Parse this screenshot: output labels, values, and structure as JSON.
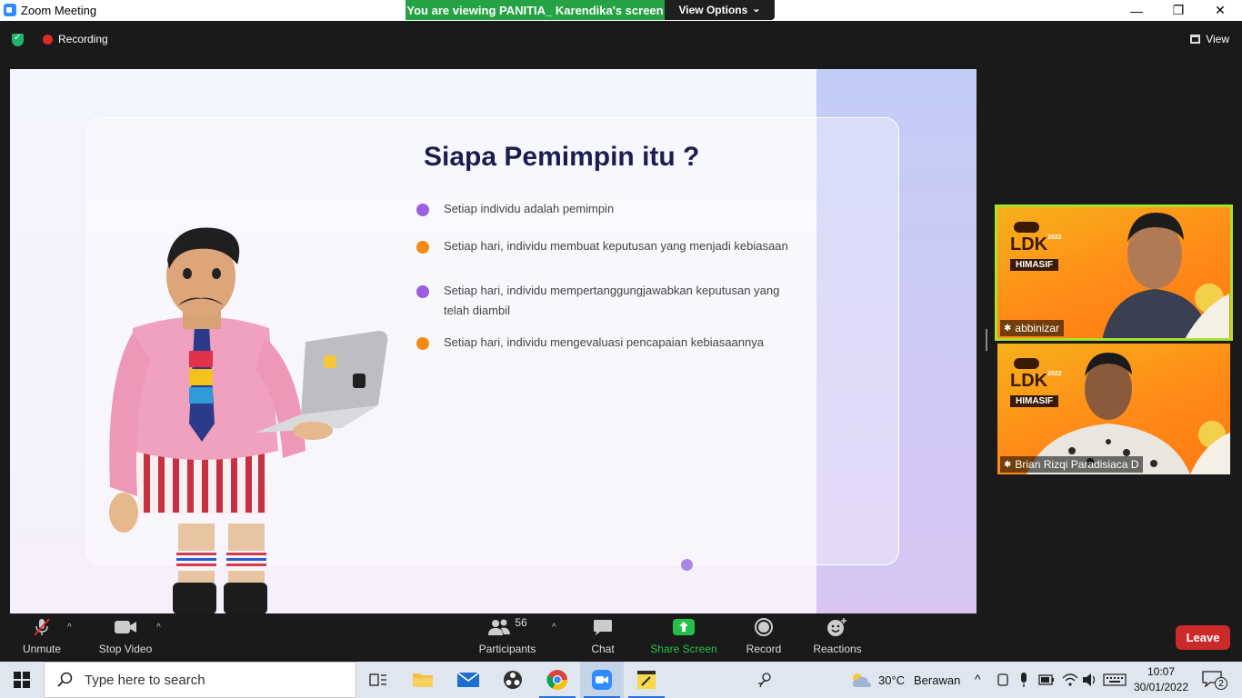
{
  "window": {
    "title": "Zoom Meeting",
    "minimize": "—",
    "restore": "❐",
    "close": "✕"
  },
  "banner": {
    "viewing_text": "You are viewing PANITIA_ Karendika's screen",
    "view_options_label": "View Options",
    "view_options_caret": "⌄"
  },
  "meeting_bar": {
    "recording_label": "Recording",
    "view_label": "View"
  },
  "slide": {
    "title": "Siapa Pemimpin itu ?",
    "bullets": [
      {
        "text": "Setiap individu adalah pemimpin",
        "color": "#9a5ee0"
      },
      {
        "text": "Setiap hari, individu membuat keputusan yang menjadi kebiasaan",
        "color": "#f58a12"
      },
      {
        "text": "Setiap hari, individu mempertanggungjawabkan keputusan yang telah diambil",
        "color": "#9a5ee0"
      },
      {
        "text": "Setiap hari, individu mengevaluasi pencapaian kebiasaannya",
        "color": "#f58a12"
      }
    ]
  },
  "participants_videos": [
    {
      "name": "abbinizar",
      "active": true,
      "logo_text": "LDK",
      "logo_year": "2022",
      "logo_org": "HIMASIF"
    },
    {
      "name": "Brian Rizqi Paradisiaca D",
      "active": false,
      "logo_text": "LDK",
      "logo_year": "2022",
      "logo_org": "HIMASIF"
    }
  ],
  "toolbar": {
    "unmute_label": "Unmute",
    "stop_video_label": "Stop Video",
    "participants_label": "Participants",
    "participants_count": "56",
    "chat_label": "Chat",
    "share_screen_label": "Share Screen",
    "record_label": "Record",
    "reactions_label": "Reactions",
    "leave_label": "Leave",
    "caret": "^"
  },
  "taskbar": {
    "search_placeholder": "Type here to search",
    "weather_temp": "30°C",
    "weather_desc": "Berawan",
    "time": "10:07",
    "date": "30/01/2022",
    "notification_count": "2"
  },
  "colors": {
    "banner_green": "#25a244",
    "share_green": "#23c14a",
    "leave_red": "#cc2a2a",
    "active_speaker": "#a6e22e",
    "slide_title": "#1b1d4f"
  }
}
